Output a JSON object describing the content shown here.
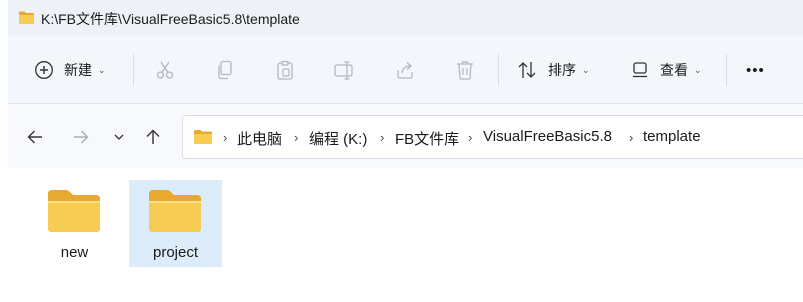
{
  "window": {
    "title": "K:\\FB文件库\\VisualFreeBasic5.8\\template",
    "title_icon": "folder-icon"
  },
  "commandbar": {
    "new_label": "新建",
    "sort_label": "排序",
    "view_label": "查看",
    "more_label": "•••",
    "icons": [
      "plus-circle-icon",
      "cut-icon",
      "copy-icon",
      "paste-icon",
      "rename-icon",
      "share-icon",
      "delete-icon",
      "sort-icon",
      "view-icon"
    ]
  },
  "navigation": {
    "breadcrumbs": [
      {
        "label": "此电脑"
      },
      {
        "label": "编程 (K:)"
      },
      {
        "label": "FB文件库"
      },
      {
        "label": "VisualFreeBasic5.8"
      },
      {
        "label": "template"
      }
    ],
    "separator": "›"
  },
  "files": [
    {
      "name": "new",
      "type": "folder",
      "selected": false
    },
    {
      "name": "project",
      "type": "folder",
      "selected": true
    }
  ],
  "colors": {
    "folder": "#f5c546",
    "folder_dark": "#e8a930",
    "selection": "#dcecfa",
    "accent": "#0067c0"
  }
}
